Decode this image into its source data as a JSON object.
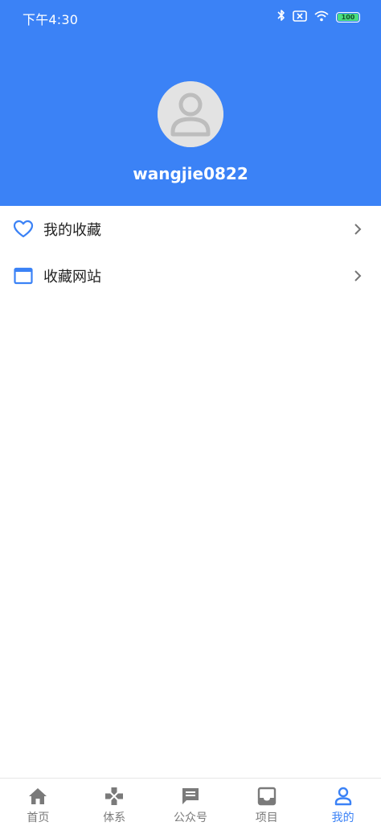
{
  "status_bar": {
    "time": "下午4:30",
    "battery": "100"
  },
  "profile": {
    "username": "wangjie0822"
  },
  "menu": {
    "items": [
      {
        "label": "我的收藏",
        "icon": "heart-icon"
      },
      {
        "label": "收藏网站",
        "icon": "browser-window-icon"
      }
    ]
  },
  "tabbar": {
    "tabs": [
      {
        "label": "首页",
        "icon": "home-icon",
        "active": false
      },
      {
        "label": "体系",
        "icon": "gamepad-icon",
        "active": false
      },
      {
        "label": "公众号",
        "icon": "message-icon",
        "active": false
      },
      {
        "label": "项目",
        "icon": "inbox-icon",
        "active": false
      },
      {
        "label": "我的",
        "icon": "person-icon",
        "active": true
      }
    ]
  },
  "colors": {
    "primary": "#3b82f6",
    "inactive": "#7a7a7a",
    "avatar_bg": "#e3e3e3",
    "avatar_fg": "#bdbdbd"
  }
}
